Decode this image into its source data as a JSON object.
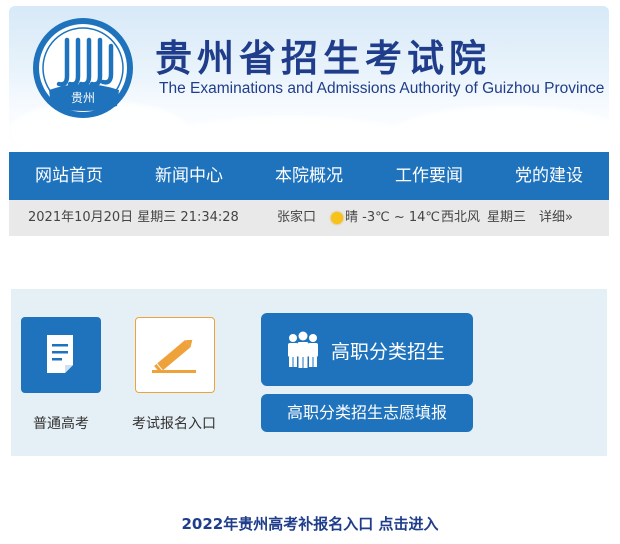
{
  "header": {
    "logo_text": "贵州",
    "title": "贵州省招生考试院",
    "subtitle": "The Examinations and Admissions Authority of Guizhou Province"
  },
  "nav": {
    "items": [
      "网站首页",
      "新闻中心",
      "本院概况",
      "工作要闻",
      "党的建设"
    ]
  },
  "infobar": {
    "datetime": "2021年10月20日 星期三 21:34:28",
    "city": "张家口",
    "weather": "晴 -3℃ ~ 14℃",
    "wind": "西北风",
    "weekday": "星期三",
    "detail_link": "详细»"
  },
  "quick_links": {
    "general_exam": "普通高考",
    "exam_signup": "考试报名入口",
    "vocational_button": "高职分类招生",
    "vocational_volunteer_button": "高职分类招生志愿填报"
  },
  "bottom_link": "2022年贵州高考补报名入口 点击进入",
  "colors": {
    "primary_blue": "#1f73bd",
    "title_blue": "#1f3d8a",
    "accent_orange": "#f0a23a",
    "panel_bg": "#e5eff6",
    "infobar_bg": "#e9e9e9"
  },
  "icons": [
    "logo-emblem-icon",
    "document-icon",
    "pencil-icon",
    "people-icon",
    "sun-icon"
  ]
}
